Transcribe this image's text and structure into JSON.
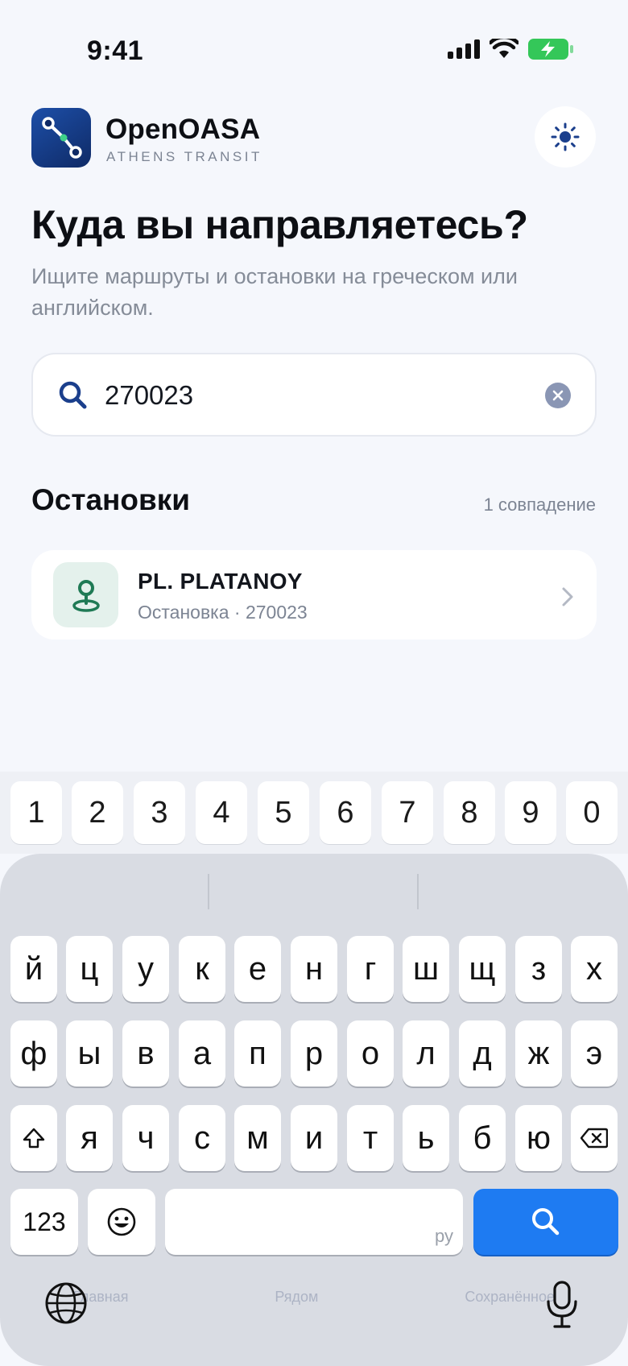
{
  "status_bar": {
    "time": "9:41",
    "icons": [
      "cellular-signal-icon",
      "wifi-icon",
      "battery-charging-icon"
    ]
  },
  "header": {
    "app_name": "OpenOASA",
    "app_subtitle": "ATHENS TRANSIT",
    "theme_icon": "sun-icon"
  },
  "hero": {
    "title": "Куда вы направляетесь?",
    "subtitle": "Ищите маршруты и остановки на греческом или английском."
  },
  "search": {
    "value": "270023",
    "icon": "search-icon",
    "clear_icon": "clear-icon"
  },
  "results": {
    "section_title": "Остановки",
    "count_label": "1 совпадение",
    "items": [
      {
        "name": "PL. PLATANOY",
        "meta": "Остановка · 270023",
        "icon": "map-pin-icon"
      }
    ]
  },
  "tab_bar_ghost": [
    "Главная",
    "Рядом",
    "Сохранённое"
  ],
  "keyboard": {
    "number_row": [
      "1",
      "2",
      "3",
      "4",
      "5",
      "6",
      "7",
      "8",
      "9",
      "0"
    ],
    "row1": [
      "й",
      "ц",
      "у",
      "к",
      "е",
      "н",
      "г",
      "ш",
      "щ",
      "з",
      "х"
    ],
    "row2": [
      "ф",
      "ы",
      "в",
      "а",
      "п",
      "р",
      "о",
      "л",
      "д",
      "ж",
      "э"
    ],
    "row3": [
      "я",
      "ч",
      "с",
      "м",
      "и",
      "т",
      "ь",
      "б",
      "ю"
    ],
    "mode_key": "123",
    "space_hint": "ру",
    "colors": {
      "accent": "#1e7bf2",
      "brand": "#1d4fa8",
      "stop_green": "#1f7a55"
    }
  }
}
